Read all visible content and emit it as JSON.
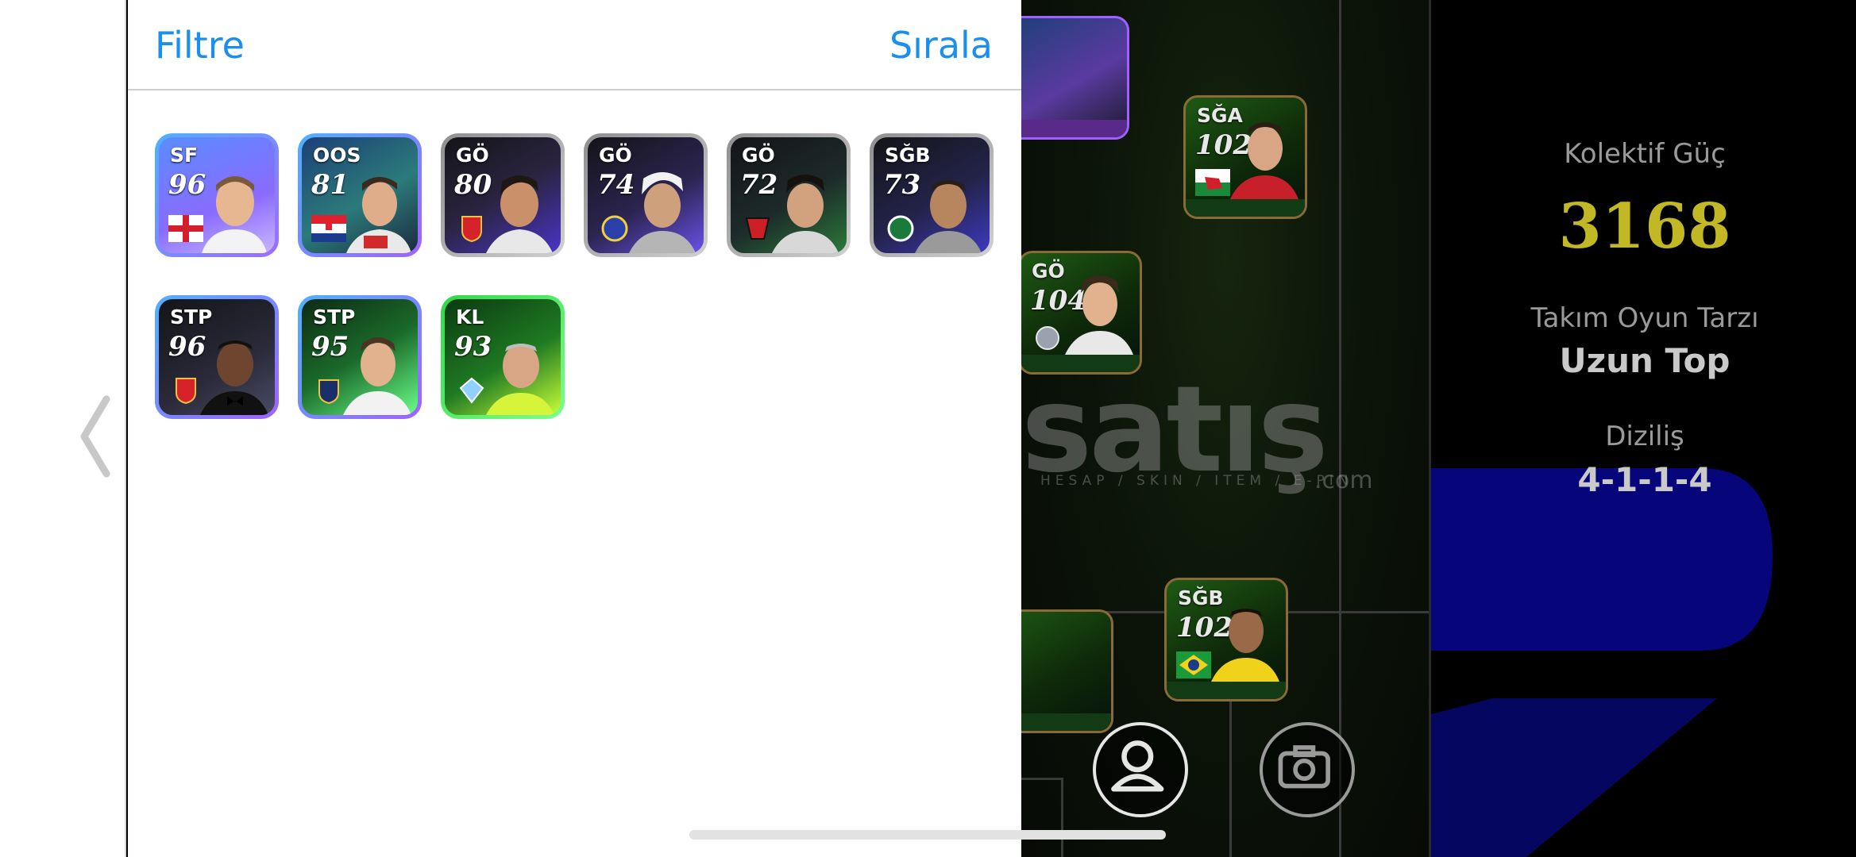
{
  "panel": {
    "filter_label": "Filtre",
    "sort_label": "Sırala",
    "cards": [
      {
        "pos": "SF",
        "rating": "96"
      },
      {
        "pos": "OOS",
        "rating": "81"
      },
      {
        "pos": "GÖ",
        "rating": "80"
      },
      {
        "pos": "GÖ",
        "rating": "74"
      },
      {
        "pos": "GÖ",
        "rating": "72"
      },
      {
        "pos": "SĞB",
        "rating": "73"
      },
      {
        "pos": "STP",
        "rating": "96"
      },
      {
        "pos": "STP",
        "rating": "95"
      },
      {
        "pos": "KL",
        "rating": "93"
      }
    ]
  },
  "pitch": {
    "cards": [
      {
        "pos": "SĞA",
        "rating": "102"
      },
      {
        "pos": "GÖ",
        "rating": "104"
      },
      {
        "pos": "SĞB",
        "rating": "102"
      }
    ],
    "watermark": "satış",
    "watermark_sub": "HESAP / SKIN / ITEM / E-PIN",
    "watermark_com": ".com"
  },
  "team": {
    "power_label": "Kolektif Güç",
    "power_value": "3168",
    "style_label": "Takım Oyun Tarzı",
    "style_value": "Uzun Top",
    "formation_label": "Diziliş",
    "formation_value": "4-1-1-4"
  },
  "icons": {
    "back": "chevron-left-icon",
    "profile": "person-icon",
    "camera": "camera-icon"
  },
  "colors": {
    "accent": "#1a8ff0",
    "power": "#c2b825"
  }
}
